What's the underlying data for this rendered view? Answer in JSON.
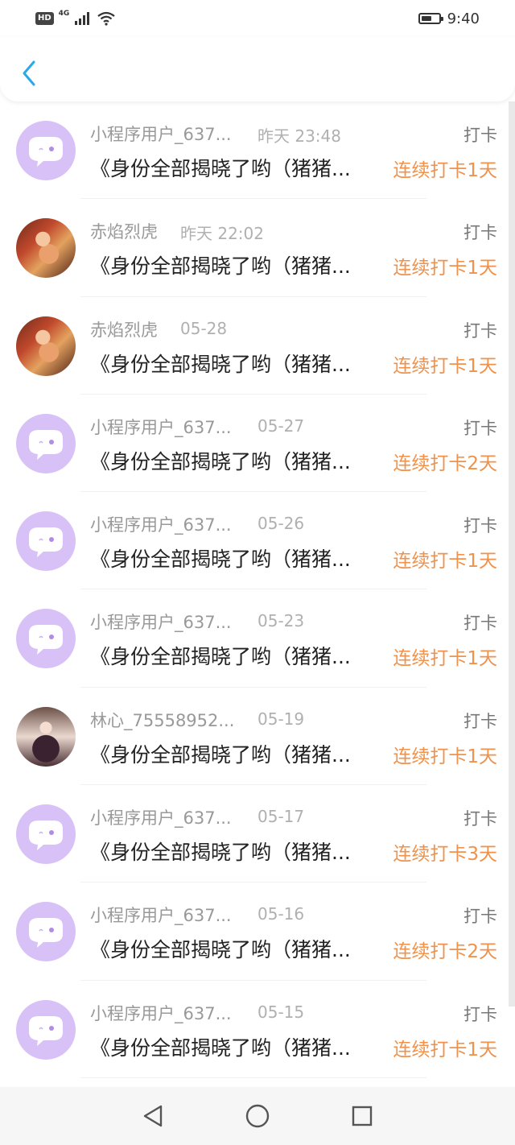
{
  "status_bar": {
    "hd": "HD",
    "network": "4G",
    "time": "9:40"
  },
  "colors": {
    "accent_back": "#2aa8e8",
    "streak": "#f0924b",
    "avatar_default": "#d7c1f6"
  },
  "records": [
    {
      "name": "小程序用户_637...",
      "time": "昨天 23:48",
      "kind": "打卡",
      "title": "《身份全部揭晓了哟（猪猪...",
      "streak": "连续打卡1天",
      "avatar": "default"
    },
    {
      "name": "赤焰烈虎",
      "time": "昨天 22:02",
      "kind": "打卡",
      "title": "《身份全部揭晓了哟（猪猪...",
      "streak": "连续打卡1天",
      "avatar": "photo-red"
    },
    {
      "name": "赤焰烈虎",
      "time": "05-28",
      "kind": "打卡",
      "title": "《身份全部揭晓了哟（猪猪...",
      "streak": "连续打卡1天",
      "avatar": "photo-red"
    },
    {
      "name": "小程序用户_637...",
      "time": "05-27",
      "kind": "打卡",
      "title": "《身份全部揭晓了哟（猪猪...",
      "streak": "连续打卡2天",
      "avatar": "default"
    },
    {
      "name": "小程序用户_637...",
      "time": "05-26",
      "kind": "打卡",
      "title": "《身份全部揭晓了哟（猪猪...",
      "streak": "连续打卡1天",
      "avatar": "default"
    },
    {
      "name": "小程序用户_637...",
      "time": "05-23",
      "kind": "打卡",
      "title": "《身份全部揭晓了哟（猪猪...",
      "streak": "连续打卡1天",
      "avatar": "default"
    },
    {
      "name": "林心_75558952...",
      "time": "05-19",
      "kind": "打卡",
      "title": "《身份全部揭晓了哟（猪猪...",
      "streak": "连续打卡1天",
      "avatar": "photo-girl"
    },
    {
      "name": "小程序用户_637...",
      "time": "05-17",
      "kind": "打卡",
      "title": "《身份全部揭晓了哟（猪猪...",
      "streak": "连续打卡3天",
      "avatar": "default"
    },
    {
      "name": "小程序用户_637...",
      "time": "05-16",
      "kind": "打卡",
      "title": "《身份全部揭晓了哟（猪猪...",
      "streak": "连续打卡2天",
      "avatar": "default"
    },
    {
      "name": "小程序用户_637...",
      "time": "05-15",
      "kind": "打卡",
      "title": "《身份全部揭晓了哟（猪猪...",
      "streak": "连续打卡1天",
      "avatar": "default"
    }
  ]
}
